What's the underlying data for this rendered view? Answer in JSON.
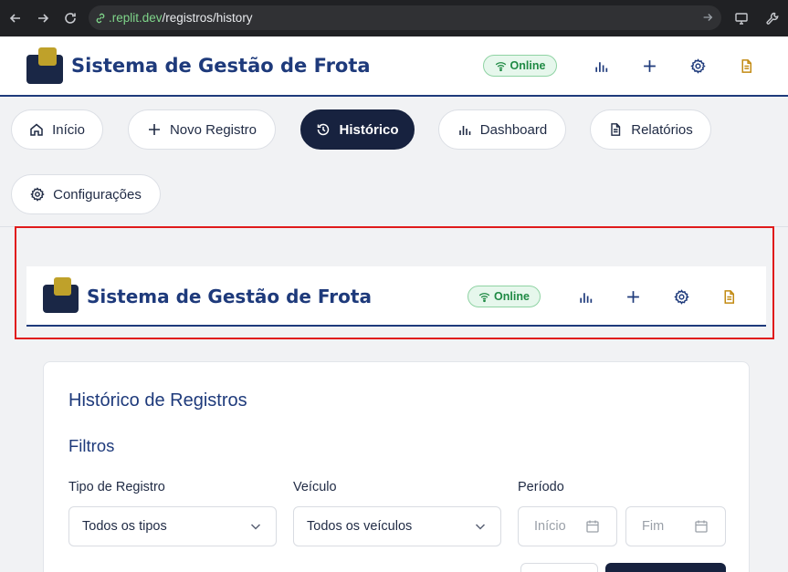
{
  "browser": {
    "url_host": ".replit.dev",
    "url_path": "/registros/history"
  },
  "header": {
    "brand": "Sistema de Gestão de Frota",
    "status": "Online",
    "icons": [
      "bar-chart-icon",
      "plus-icon",
      "gear-icon",
      "document-icon"
    ],
    "colors": {
      "brand": "#1e3a7b",
      "logo_dark": "#1a2746",
      "logo_gold": "#bfa12a",
      "online_green": "#1f8a44"
    }
  },
  "nav": {
    "items": [
      {
        "label": "Início",
        "icon": "home-icon",
        "active": false
      },
      {
        "label": "Novo Registro",
        "icon": "plus-icon",
        "active": false
      },
      {
        "label": "Histórico",
        "icon": "history-icon",
        "active": true
      },
      {
        "label": "Dashboard",
        "icon": "bar-chart-icon",
        "active": false
      },
      {
        "label": "Relatórios",
        "icon": "document-icon",
        "active": false
      },
      {
        "label": "Configurações",
        "icon": "gear-icon",
        "active": false
      }
    ]
  },
  "embedded_header": {
    "brand": "Sistema de Gestão de Frota",
    "status": "Online"
  },
  "history": {
    "title": "Histórico de Registros",
    "filters_title": "Filtros",
    "record_type": {
      "label": "Tipo de Registro",
      "value": "Todos os tipos"
    },
    "vehicle": {
      "label": "Veículo",
      "value": "Todos os veículos"
    },
    "period": {
      "label": "Período",
      "start_placeholder": "Início",
      "end_placeholder": "Fim"
    }
  }
}
